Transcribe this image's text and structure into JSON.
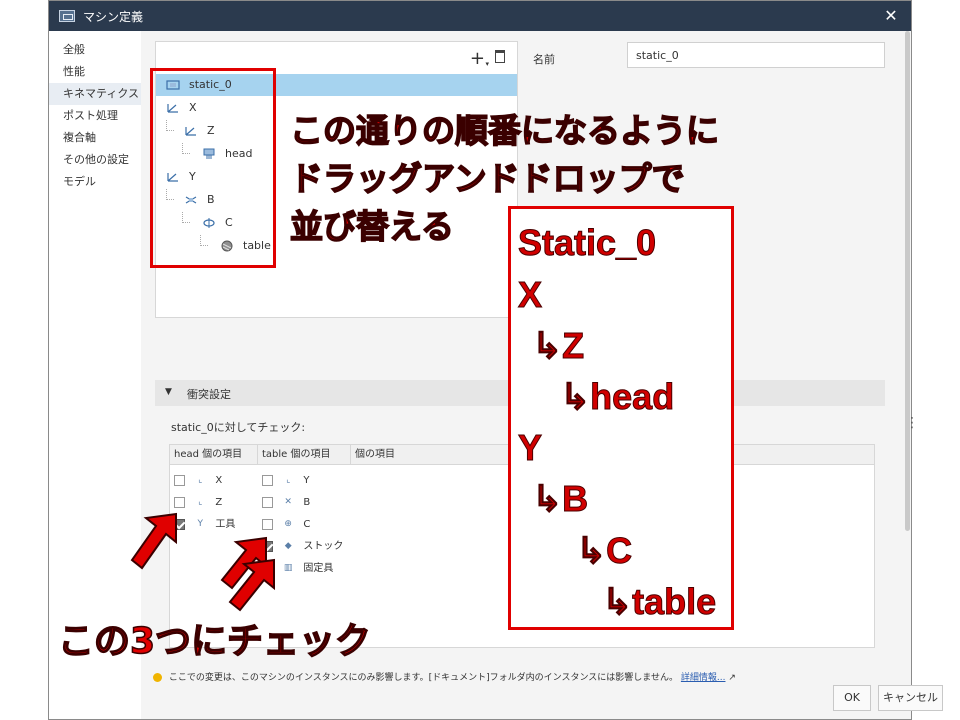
{
  "window": {
    "title": "マシン定義",
    "close_glyph": "✕"
  },
  "sidebar": {
    "items": [
      {
        "label": "全般"
      },
      {
        "label": "性能"
      },
      {
        "label": "キネマティクス",
        "selected": true
      },
      {
        "label": "ポスト処理"
      },
      {
        "label": "複合軸"
      },
      {
        "label": "その他の設定"
      },
      {
        "label": "モデル"
      }
    ]
  },
  "toolbar": {
    "add_glyph": "+",
    "add_caret": "▾"
  },
  "tree": {
    "nodes": [
      {
        "label": "static_0",
        "icon": "machine-icon",
        "selected": true
      },
      {
        "label": "X",
        "icon": "linear-axis-icon"
      },
      {
        "label": "Z",
        "icon": "linear-axis-icon"
      },
      {
        "label": "head",
        "icon": "head-icon"
      },
      {
        "label": "Y",
        "icon": "linear-axis-icon"
      },
      {
        "label": "B",
        "icon": "rotary-axis-icon"
      },
      {
        "label": "C",
        "icon": "rotary-axis-icon"
      },
      {
        "label": "table",
        "icon": "table-icon"
      }
    ]
  },
  "name_field": {
    "label": "名前",
    "value": "static_0"
  },
  "collision": {
    "header": "衝突設定",
    "check_label": "static_0に対してチェック:",
    "kebab": "⋮",
    "columns": [
      "head 個の項目",
      "table 個の項目",
      "個の項目"
    ],
    "head_items": [
      {
        "label": "X",
        "icon": "linear-axis-icon",
        "checked": false
      },
      {
        "label": "Z",
        "icon": "linear-axis-icon",
        "checked": false
      },
      {
        "label": "工具",
        "icon": "tool-icon",
        "checked": true
      }
    ],
    "table_items": [
      {
        "label": "Y",
        "icon": "linear-axis-icon",
        "checked": false
      },
      {
        "label": "B",
        "icon": "rotary-axis-icon",
        "checked": false
      },
      {
        "label": "C",
        "icon": "rotary-axis-icon",
        "checked": false
      },
      {
        "label": "ストック",
        "icon": "stock-icon",
        "checked": true
      },
      {
        "label": "固定具",
        "icon": "fixture-icon",
        "checked": true
      }
    ]
  },
  "footer": {
    "note": "ここでの変更は、このマシンのインスタンスにのみ影響します。[ドキュメント]フォルダ内のインスタンスには影響しません。",
    "link": "詳細情報..."
  },
  "buttons": {
    "ok": "OK",
    "cancel": "キャンセル"
  },
  "annotations": {
    "instruction_lines": [
      "この通りの順番になるように",
      "ドラッグアンドドロップで",
      "並び替える"
    ],
    "order_list": [
      "Static_0",
      "X",
      "↳Z",
      "↳head",
      "Y",
      "↳B",
      "↳C",
      "↳table"
    ],
    "check_instruction": "この3つにチェック",
    "color": "#e00000"
  }
}
